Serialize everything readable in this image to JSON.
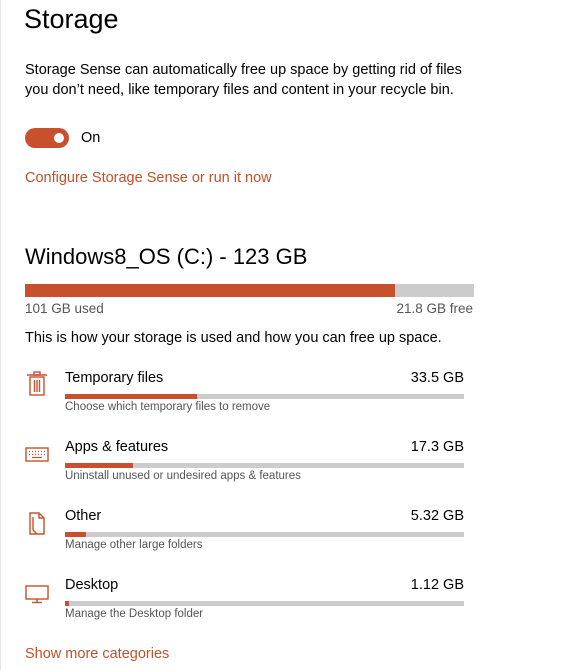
{
  "header": {
    "title": "Storage"
  },
  "storage_sense": {
    "description": "Storage Sense can automatically free up space by getting rid of files you don’t need, like temporary files and content in your recycle bin.",
    "toggle_state": "On",
    "configure_link": "Configure Storage Sense or run it now"
  },
  "drive": {
    "title": "Windows8_OS (C:) - 123 GB",
    "used_label": "101 GB used",
    "free_label": "21.8 GB free",
    "used_fraction": 0.824
  },
  "usage_intro": "This is how your storage is used and how you can free up space.",
  "categories": [
    {
      "icon": "trash-icon",
      "name": "Temporary files",
      "size": "33.5 GB",
      "description": "Choose which temporary files to remove",
      "fraction": 0.332
    },
    {
      "icon": "keyboard-icon",
      "name": "Apps & features",
      "size": "17.3 GB",
      "description": "Uninstall unused or undesired apps & features",
      "fraction": 0.171
    },
    {
      "icon": "document-icon",
      "name": "Other",
      "size": "5.32 GB",
      "description": "Manage other large folders",
      "fraction": 0.053
    },
    {
      "icon": "monitor-icon",
      "name": "Desktop",
      "size": "1.12 GB",
      "description": "Manage the Desktop folder",
      "fraction": 0.011
    }
  ],
  "show_more": "Show more categories",
  "colors": {
    "accent": "#c8502d",
    "track": "#cccccc",
    "link": "#c0502a"
  }
}
